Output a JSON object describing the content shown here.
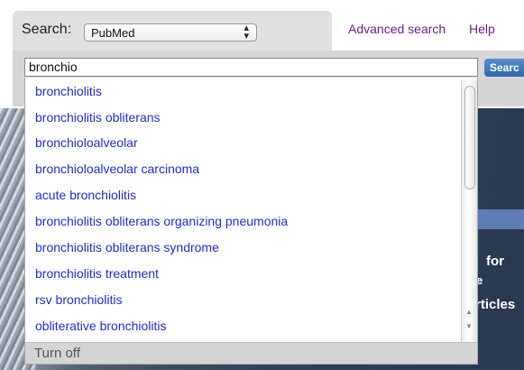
{
  "hero": {
    "text_1": "for",
    "text_2": "e",
    "text_3": "rticles"
  },
  "search": {
    "label": "Search:",
    "database": "PubMed",
    "query": "bronchio",
    "button_label": "Searc"
  },
  "links": {
    "advanced": "Advanced search",
    "help": "Help"
  },
  "suggestions": [
    "bronchiolitis",
    "bronchiolitis obliterans",
    "bronchioloalveolar",
    "bronchioloalveolar carcinoma",
    "acute bronchiolitis",
    "bronchiolitis obliterans organizing pneumonia",
    "bronchiolitis obliterans syndrome",
    "bronchiolitis treatment",
    "rsv bronchiolitis",
    "obliterative bronchiolitis"
  ],
  "footer": {
    "turn_off": "Turn off"
  },
  "colors": {
    "suggestion_link": "#1f2dd6",
    "nav_link": "#6a1e8a",
    "search_button": "#2f6aae",
    "hero_band": "#5d7db6"
  }
}
